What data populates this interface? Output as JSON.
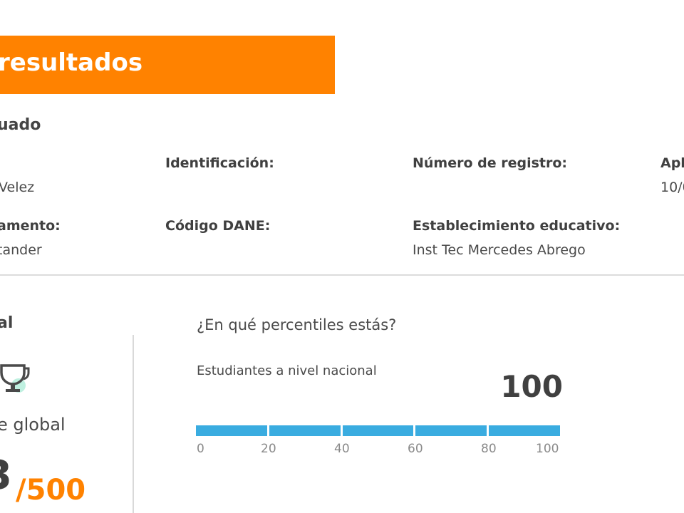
{
  "header": {
    "title": "resultados"
  },
  "evaluated_section": {
    "title": "uado",
    "fields": [
      {
        "label": "",
        "value": "Velez"
      },
      {
        "label": "Identificación:",
        "value": ""
      },
      {
        "label": "Número de registro:",
        "value": ""
      },
      {
        "label": "Apl",
        "value": "10/0"
      },
      {
        "label": "amento:",
        "value": "tander"
      },
      {
        "label": "Código DANE:",
        "value": ""
      },
      {
        "label": "Establecimiento educativo:",
        "value": "Inst Tec Mercedes Abrego"
      }
    ]
  },
  "global": {
    "title": "al",
    "icon": "trophy-icon",
    "score_label": "e global",
    "score_value": "3",
    "score_max": "/500"
  },
  "percentiles": {
    "question": "¿En qué percentiles estás?",
    "group_label": "Estudiantes a nivel nacional",
    "value": "100",
    "fill_percent": 100,
    "ticks": [
      "0",
      "20",
      "40",
      "60",
      "80",
      "100"
    ]
  },
  "colors": {
    "accent": "#ff8200",
    "bar": "#3aace0",
    "text": "#4a4a4a"
  }
}
